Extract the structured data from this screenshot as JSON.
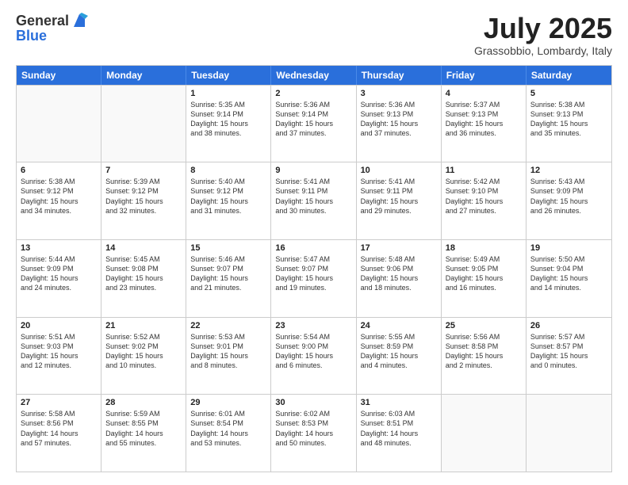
{
  "header": {
    "logo_general": "General",
    "logo_blue": "Blue",
    "month": "July 2025",
    "location": "Grassobbio, Lombardy, Italy"
  },
  "days_of_week": [
    "Sunday",
    "Monday",
    "Tuesday",
    "Wednesday",
    "Thursday",
    "Friday",
    "Saturday"
  ],
  "weeks": [
    [
      {
        "day": "",
        "text": ""
      },
      {
        "day": "",
        "text": ""
      },
      {
        "day": "1",
        "text": "Sunrise: 5:35 AM\nSunset: 9:14 PM\nDaylight: 15 hours\nand 38 minutes."
      },
      {
        "day": "2",
        "text": "Sunrise: 5:36 AM\nSunset: 9:14 PM\nDaylight: 15 hours\nand 37 minutes."
      },
      {
        "day": "3",
        "text": "Sunrise: 5:36 AM\nSunset: 9:13 PM\nDaylight: 15 hours\nand 37 minutes."
      },
      {
        "day": "4",
        "text": "Sunrise: 5:37 AM\nSunset: 9:13 PM\nDaylight: 15 hours\nand 36 minutes."
      },
      {
        "day": "5",
        "text": "Sunrise: 5:38 AM\nSunset: 9:13 PM\nDaylight: 15 hours\nand 35 minutes."
      }
    ],
    [
      {
        "day": "6",
        "text": "Sunrise: 5:38 AM\nSunset: 9:12 PM\nDaylight: 15 hours\nand 34 minutes."
      },
      {
        "day": "7",
        "text": "Sunrise: 5:39 AM\nSunset: 9:12 PM\nDaylight: 15 hours\nand 32 minutes."
      },
      {
        "day": "8",
        "text": "Sunrise: 5:40 AM\nSunset: 9:12 PM\nDaylight: 15 hours\nand 31 minutes."
      },
      {
        "day": "9",
        "text": "Sunrise: 5:41 AM\nSunset: 9:11 PM\nDaylight: 15 hours\nand 30 minutes."
      },
      {
        "day": "10",
        "text": "Sunrise: 5:41 AM\nSunset: 9:11 PM\nDaylight: 15 hours\nand 29 minutes."
      },
      {
        "day": "11",
        "text": "Sunrise: 5:42 AM\nSunset: 9:10 PM\nDaylight: 15 hours\nand 27 minutes."
      },
      {
        "day": "12",
        "text": "Sunrise: 5:43 AM\nSunset: 9:09 PM\nDaylight: 15 hours\nand 26 minutes."
      }
    ],
    [
      {
        "day": "13",
        "text": "Sunrise: 5:44 AM\nSunset: 9:09 PM\nDaylight: 15 hours\nand 24 minutes."
      },
      {
        "day": "14",
        "text": "Sunrise: 5:45 AM\nSunset: 9:08 PM\nDaylight: 15 hours\nand 23 minutes."
      },
      {
        "day": "15",
        "text": "Sunrise: 5:46 AM\nSunset: 9:07 PM\nDaylight: 15 hours\nand 21 minutes."
      },
      {
        "day": "16",
        "text": "Sunrise: 5:47 AM\nSunset: 9:07 PM\nDaylight: 15 hours\nand 19 minutes."
      },
      {
        "day": "17",
        "text": "Sunrise: 5:48 AM\nSunset: 9:06 PM\nDaylight: 15 hours\nand 18 minutes."
      },
      {
        "day": "18",
        "text": "Sunrise: 5:49 AM\nSunset: 9:05 PM\nDaylight: 15 hours\nand 16 minutes."
      },
      {
        "day": "19",
        "text": "Sunrise: 5:50 AM\nSunset: 9:04 PM\nDaylight: 15 hours\nand 14 minutes."
      }
    ],
    [
      {
        "day": "20",
        "text": "Sunrise: 5:51 AM\nSunset: 9:03 PM\nDaylight: 15 hours\nand 12 minutes."
      },
      {
        "day": "21",
        "text": "Sunrise: 5:52 AM\nSunset: 9:02 PM\nDaylight: 15 hours\nand 10 minutes."
      },
      {
        "day": "22",
        "text": "Sunrise: 5:53 AM\nSunset: 9:01 PM\nDaylight: 15 hours\nand 8 minutes."
      },
      {
        "day": "23",
        "text": "Sunrise: 5:54 AM\nSunset: 9:00 PM\nDaylight: 15 hours\nand 6 minutes."
      },
      {
        "day": "24",
        "text": "Sunrise: 5:55 AM\nSunset: 8:59 PM\nDaylight: 15 hours\nand 4 minutes."
      },
      {
        "day": "25",
        "text": "Sunrise: 5:56 AM\nSunset: 8:58 PM\nDaylight: 15 hours\nand 2 minutes."
      },
      {
        "day": "26",
        "text": "Sunrise: 5:57 AM\nSunset: 8:57 PM\nDaylight: 15 hours\nand 0 minutes."
      }
    ],
    [
      {
        "day": "27",
        "text": "Sunrise: 5:58 AM\nSunset: 8:56 PM\nDaylight: 14 hours\nand 57 minutes."
      },
      {
        "day": "28",
        "text": "Sunrise: 5:59 AM\nSunset: 8:55 PM\nDaylight: 14 hours\nand 55 minutes."
      },
      {
        "day": "29",
        "text": "Sunrise: 6:01 AM\nSunset: 8:54 PM\nDaylight: 14 hours\nand 53 minutes."
      },
      {
        "day": "30",
        "text": "Sunrise: 6:02 AM\nSunset: 8:53 PM\nDaylight: 14 hours\nand 50 minutes."
      },
      {
        "day": "31",
        "text": "Sunrise: 6:03 AM\nSunset: 8:51 PM\nDaylight: 14 hours\nand 48 minutes."
      },
      {
        "day": "",
        "text": ""
      },
      {
        "day": "",
        "text": ""
      }
    ]
  ]
}
